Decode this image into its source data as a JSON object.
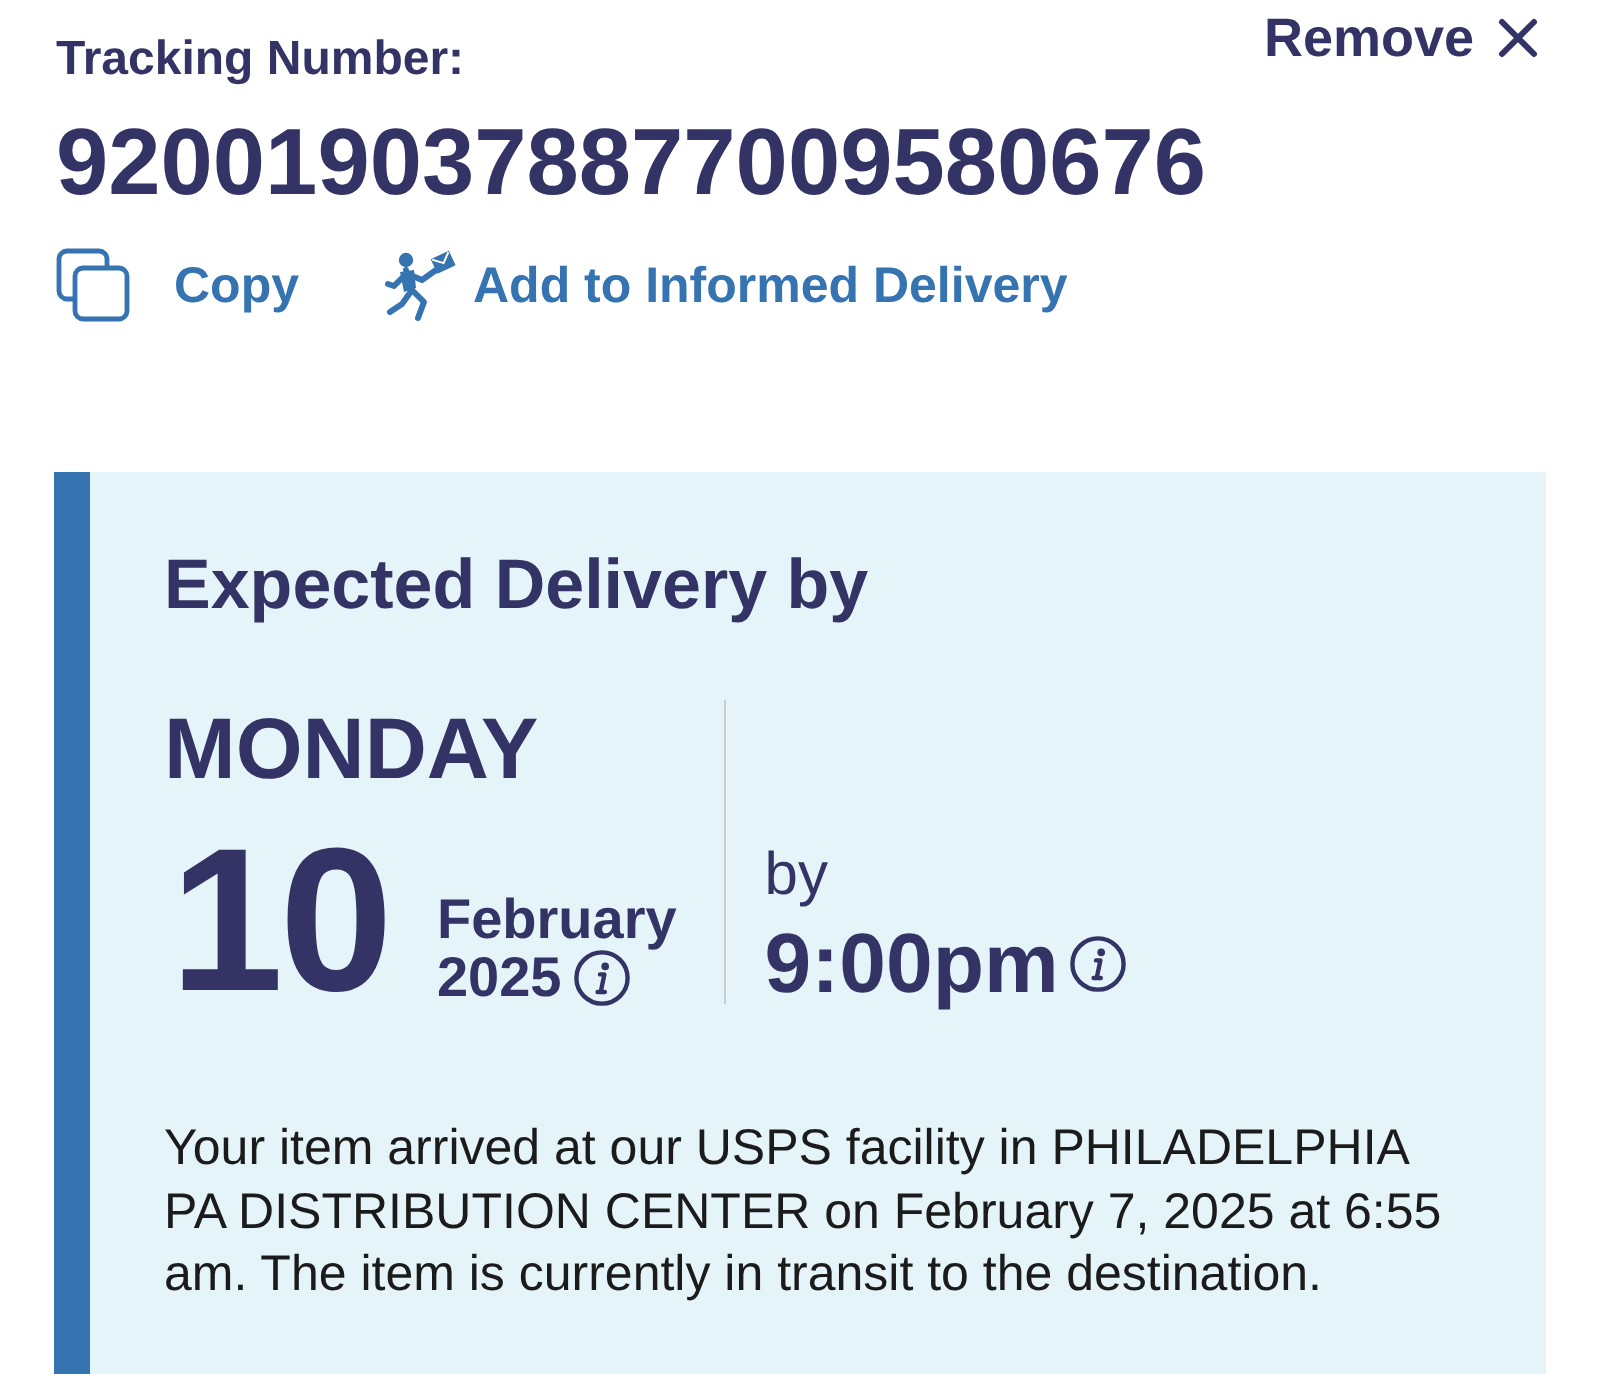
{
  "remove": {
    "label": "Remove"
  },
  "tracking": {
    "label": "Tracking Number:",
    "number": "9200190378877009580676"
  },
  "actions": [
    {
      "kind": "copy",
      "label": "Copy"
    },
    {
      "kind": "informed-delivery",
      "label": "Add to Informed Delivery"
    }
  ],
  "delivery": {
    "heading": "Expected Delivery by",
    "weekday": "MONDAY",
    "day": "10",
    "month": "February",
    "year": "2025",
    "by_label": "by",
    "time": "9:00pm",
    "status_text": "Your item arrived at our USPS facility in PHILADELPHIA PA DISTRIBUTION CENTER on February 7, 2025 at 6:55 am. The item is currently in transit to the destination."
  }
}
